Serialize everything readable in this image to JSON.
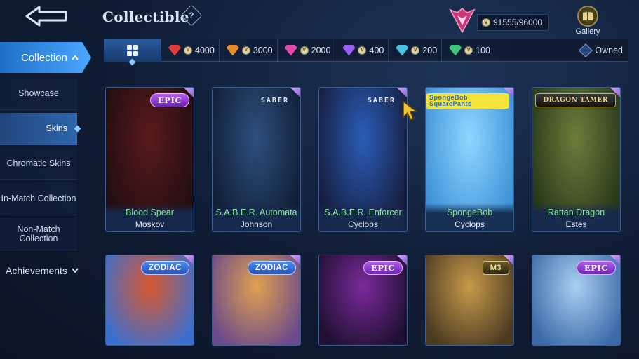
{
  "header": {
    "title": "Collectible",
    "points": "91555/96000",
    "gallery_label": "Gallery"
  },
  "sidebar": {
    "main": "Collection",
    "items": [
      {
        "label": "Showcase"
      },
      {
        "label": "Skins"
      },
      {
        "label": "Chromatic Skins"
      },
      {
        "label": "In-Match Collection"
      },
      {
        "label": "Non-Match Collection"
      }
    ],
    "achievements": "Achievements"
  },
  "filters": [
    {
      "value": "4000",
      "color": "#e23b3b"
    },
    {
      "value": "3000",
      "color": "#e58a2a"
    },
    {
      "value": "2000",
      "color": "#e04aa8"
    },
    {
      "value": "400",
      "color": "#9b5ef0"
    },
    {
      "value": "200",
      "color": "#48c0e0"
    },
    {
      "value": "100",
      "color": "#3fc27a"
    }
  ],
  "owned_label": "Owned",
  "skins": [
    {
      "skin": "Blood Spear",
      "hero": "Moskov",
      "tag": "EPIC",
      "tag_type": "epic",
      "art": [
        "#5a1a1a",
        "#1e0d10"
      ]
    },
    {
      "skin": "S.A.B.E.R. Automata",
      "hero": "Johnson",
      "tag": "SABER",
      "tag_type": "saber",
      "art": [
        "#2f4f7e",
        "#0e1c33"
      ]
    },
    {
      "skin": "S.A.B.E.R. Enforcer",
      "hero": "Cyclops",
      "tag": "SABER",
      "tag_type": "saber",
      "art": [
        "#2a5db8",
        "#161a38"
      ]
    },
    {
      "skin": "SpongeBob",
      "hero": "Cyclops",
      "tag": "SpongeBob SquarePants",
      "tag_type": "sponge",
      "art": [
        "#8fd6ff",
        "#3b8fd6"
      ]
    },
    {
      "skin": "Rattan Dragon",
      "hero": "Estes",
      "tag": "DRAGON TAMER",
      "tag_type": "dragon",
      "art": [
        "#6c7d3a",
        "#24351a"
      ]
    },
    {
      "skin": "",
      "hero": "",
      "tag": "ZODIAC",
      "tag_type": "zodiac",
      "art": [
        "#d8582e",
        "#3a6fd0"
      ]
    },
    {
      "skin": "",
      "hero": "",
      "tag": "ZODIAC",
      "tag_type": "zodiac",
      "art": [
        "#e0a050",
        "#6a4a8a"
      ]
    },
    {
      "skin": "",
      "hero": "",
      "tag": "EPIC",
      "tag_type": "epic",
      "art": [
        "#7a2a9a",
        "#1e1030"
      ]
    },
    {
      "skin": "",
      "hero": "",
      "tag": "M3",
      "tag_type": "m3",
      "art": [
        "#c79a4a",
        "#4a3a22"
      ]
    },
    {
      "skin": "",
      "hero": "",
      "tag": "EPIC",
      "tag_type": "epic",
      "art": [
        "#a8d0f0",
        "#3a6aa8"
      ]
    }
  ]
}
